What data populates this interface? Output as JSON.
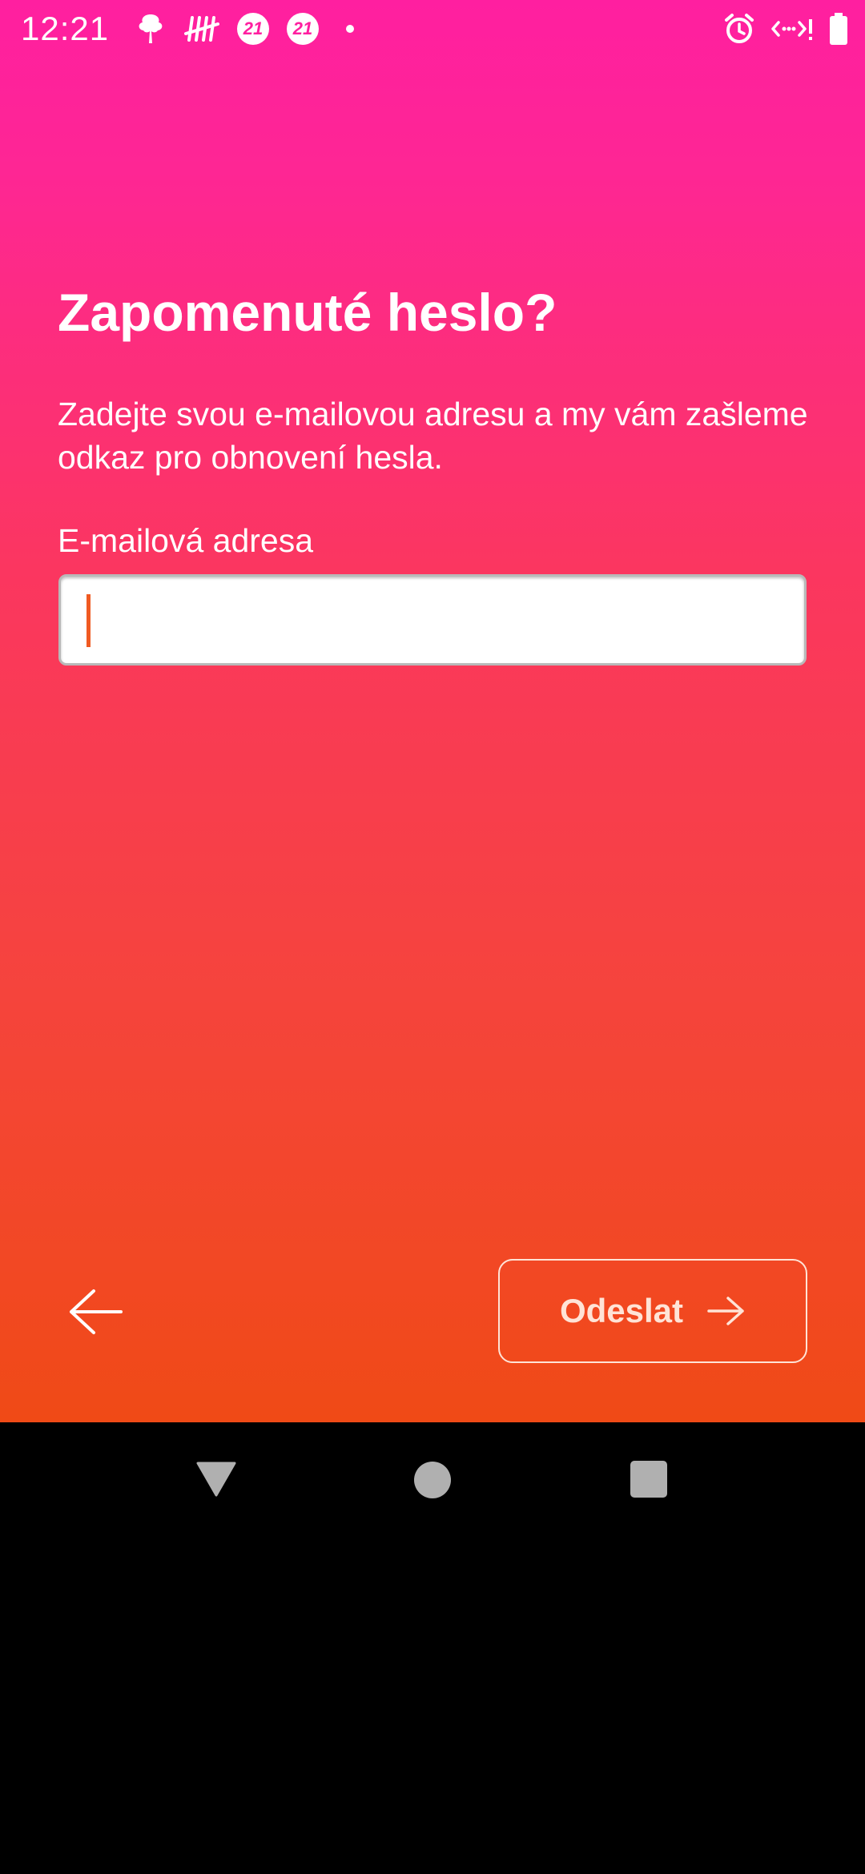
{
  "status_bar": {
    "time": "12:21",
    "badge_1": "21",
    "badge_2": "21",
    "icons_left": [
      "tree-notification-icon",
      "tally-notification-icon",
      "badge-21-icon",
      "badge-21-icon",
      "dot-icon"
    ],
    "icons_right": [
      "alarm-icon",
      "data-saver-icon",
      "battery-icon"
    ]
  },
  "page": {
    "title": "Zapomenuté heslo?",
    "description": "Zadejte svou e-mailovou adresu a my vám zašleme odkaz pro obnovení hesla.",
    "email_label": "E-mailová adresa",
    "email_value": "",
    "email_placeholder": ""
  },
  "actions": {
    "back_icon": "arrow-left-icon",
    "submit_label": "Odeslat",
    "submit_icon": "arrow-right-icon"
  },
  "navigation_bar": {
    "buttons": [
      "back-triangle-icon",
      "home-circle-icon",
      "recents-square-icon"
    ]
  },
  "colors": {
    "gradient_top": "#ff1fa0",
    "gradient_bottom": "#f04a16",
    "caret": "#f05a22",
    "text": "#ffffff"
  }
}
